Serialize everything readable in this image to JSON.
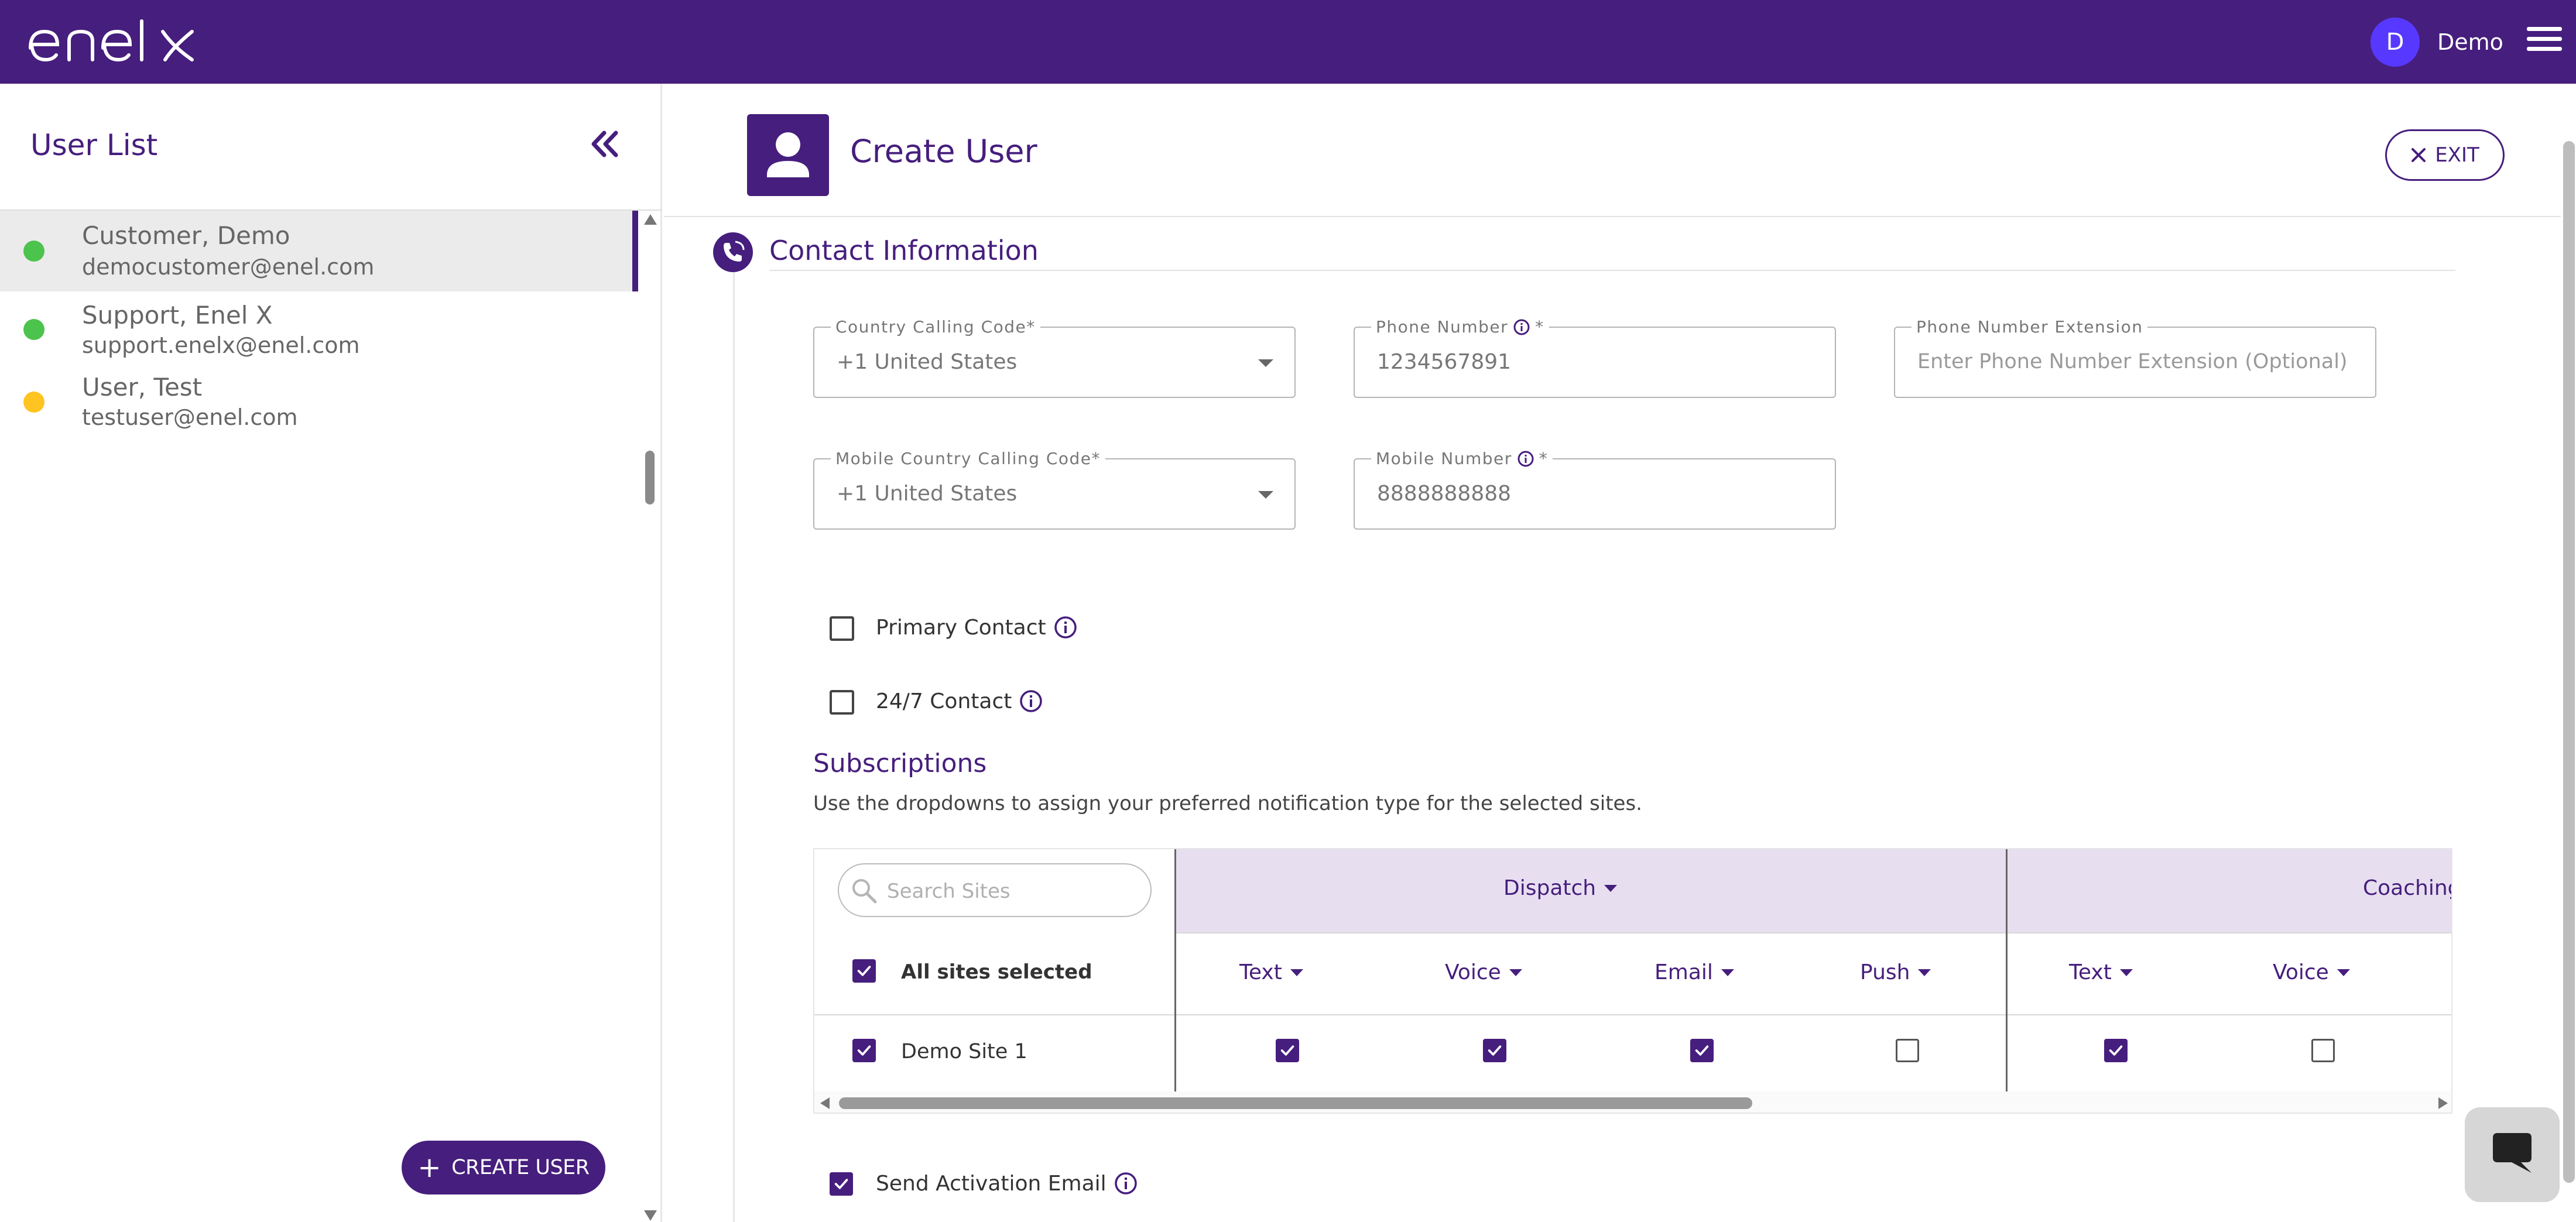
{
  "app": {
    "brand": "enel x",
    "colors": {
      "primary": "#461e7d",
      "avatar": "#5738ff",
      "status_active": "#4cc34c",
      "status_pending": "#ffc322"
    }
  },
  "topbar": {
    "avatar_initial": "D",
    "user_name": "Demo",
    "icons": {
      "logo": "enel-x-logo",
      "menu": "hamburger-menu-icon"
    }
  },
  "sidebar": {
    "title": "User List",
    "collapse_icon": "double-chevron-left-icon",
    "users": [
      {
        "name": "Customer, Demo",
        "email": "democustomer@enel.com",
        "status": "active",
        "selected": true
      },
      {
        "name": "Support, Enel X",
        "email": "support.enelx@enel.com",
        "status": "active",
        "selected": false
      },
      {
        "name": "User, Test",
        "email": "testuser@enel.com",
        "status": "pending",
        "selected": false
      }
    ],
    "create_button": "CREATE USER"
  },
  "main": {
    "title": "Create User",
    "exit_label": "EXIT",
    "contact_section": {
      "title": "Contact Information",
      "fields": {
        "country_code": {
          "label": "Country Calling Code*",
          "value": "+1 United States"
        },
        "phone_number": {
          "label": "Phone Number",
          "required_mark": "*",
          "value": "1234567891"
        },
        "phone_extension": {
          "label": "Phone Number Extension",
          "placeholder": "Enter Phone Number Extension (Optional)"
        },
        "mobile_country_code": {
          "label": "Mobile Country Calling Code*",
          "value": "+1 United States"
        },
        "mobile_number": {
          "label": "Mobile Number",
          "required_mark": "*",
          "value": "8888888888"
        }
      },
      "primary_contact": {
        "label": "Primary Contact",
        "checked": false
      },
      "contact_24_7": {
        "label": "24/7 Contact",
        "checked": false
      }
    },
    "subscriptions": {
      "title": "Subscriptions",
      "description": "Use the dropdowns to assign your preferred notification type for the selected sites.",
      "search_placeholder": "Search Sites",
      "all_sites_label": "All sites selected",
      "groups": [
        "Dispatch",
        "Coaching"
      ],
      "columns": [
        "Text",
        "Voice",
        "Email",
        "Push",
        "Text",
        "Voice"
      ],
      "rows": [
        {
          "site": "Demo Site 1",
          "selected": true,
          "values": [
            true,
            true,
            true,
            false,
            true,
            false
          ]
        }
      ]
    },
    "send_activation": {
      "label": "Send Activation Email",
      "checked": true
    }
  }
}
